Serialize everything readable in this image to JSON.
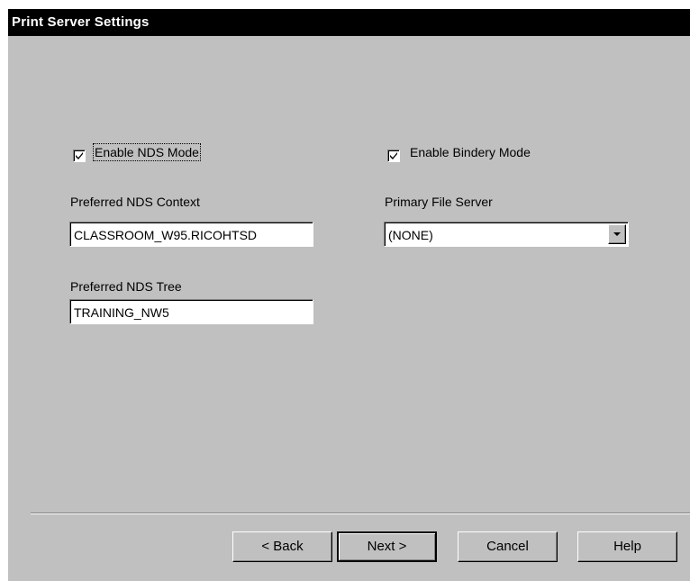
{
  "dialog": {
    "title": "Print Server Settings"
  },
  "nds": {
    "enable_label": "Enable NDS Mode",
    "enable_checked": true,
    "context_label": "Preferred NDS Context",
    "context_value": "CLASSROOM_W95.RICOHTSD",
    "tree_label": "Preferred NDS Tree",
    "tree_value": "TRAINING_NW5"
  },
  "bindery": {
    "enable_label": "Enable Bindery Mode",
    "enable_checked": true,
    "server_label": "Primary File Server",
    "server_value": "(NONE)"
  },
  "buttons": {
    "back": "< Back",
    "next": "Next >",
    "cancel": "Cancel",
    "help": "Help"
  },
  "icons": {
    "checkmark": "checkmark-icon",
    "dropdown": "chevron-down-icon"
  }
}
